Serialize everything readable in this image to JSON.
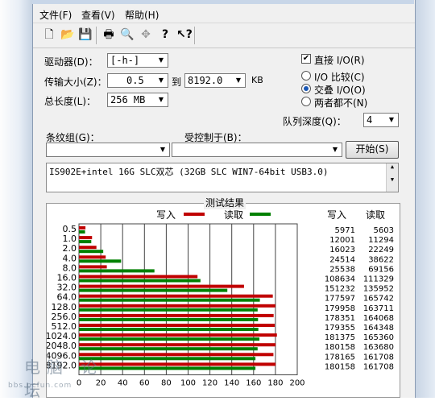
{
  "menu": [
    {
      "label": "文件(F)",
      "x": 8
    },
    {
      "label": "查看(V)",
      "x": 60
    },
    {
      "label": "帮助(H)",
      "x": 114
    }
  ],
  "toolbar_icons": [
    "new-icon",
    "open-icon",
    "save-icon",
    "print-icon",
    "print-preview-icon",
    "move-icon",
    "help-icon",
    "context-help-icon"
  ],
  "form": {
    "drive_label": "驱动器(D)：",
    "drive_value": "[-h-]",
    "transfer_label": "传输大小(Z)：",
    "transfer_from": "0.5",
    "to_label": "到",
    "transfer_to": "8192.0",
    "kb_unit": "KB",
    "total_label": "总长度(L)：",
    "total_value": "256 MB",
    "direct_io_label": "直接 I/O(R)",
    "io_compare_label": "I/O 比较(C)",
    "overlap_io_label": "交叠 I/O(O)",
    "neither_label": "两者都不(N)",
    "queue_label": "队列深度(Q)：",
    "queue_value": "4",
    "stripe_label": "条纹组(G)：",
    "controlled_label": "受控制于(B)：",
    "start_button": "开始(S)",
    "description": "IS902E+intel 16G SLC双芯 (32GB SLC WIN7-64bit USB3.0)"
  },
  "results": {
    "title": "测试结果",
    "legend_write": "写入",
    "legend_read": "读取",
    "col_write": "写入",
    "col_read": "读取",
    "write_color": "#c00000",
    "read_color": "#008000"
  },
  "chart_data": {
    "type": "bar",
    "orientation": "horizontal",
    "categories": [
      "0.5",
      "1.0",
      "2.0",
      "4.0",
      "8.0",
      "16.0",
      "32.0",
      "64.0",
      "128.0",
      "256.0",
      "512.0",
      "1024.0",
      "2048.0",
      "4096.0",
      "8192.0"
    ],
    "series": [
      {
        "name": "写入",
        "values": [
          5971,
          12001,
          16023,
          24514,
          25538,
          108634,
          151232,
          177597,
          179958,
          178351,
          179355,
          181375,
          180158,
          178165,
          180158
        ]
      },
      {
        "name": "读取",
        "values": [
          5603,
          11294,
          22249,
          38622,
          69156,
          111329,
          135952,
          165742,
          163711,
          164068,
          164348,
          165360,
          163680,
          161708,
          161708
        ]
      }
    ],
    "xlim": [
      0,
      200
    ],
    "x_ticks": [
      "0",
      "20",
      "40",
      "60",
      "80",
      "100",
      "120",
      "140",
      "160",
      "180",
      "200"
    ],
    "x_unit_scale": 1000
  },
  "watermark": {
    "text": "电脑 论坛",
    "url": "bbs.pcfun.com"
  }
}
